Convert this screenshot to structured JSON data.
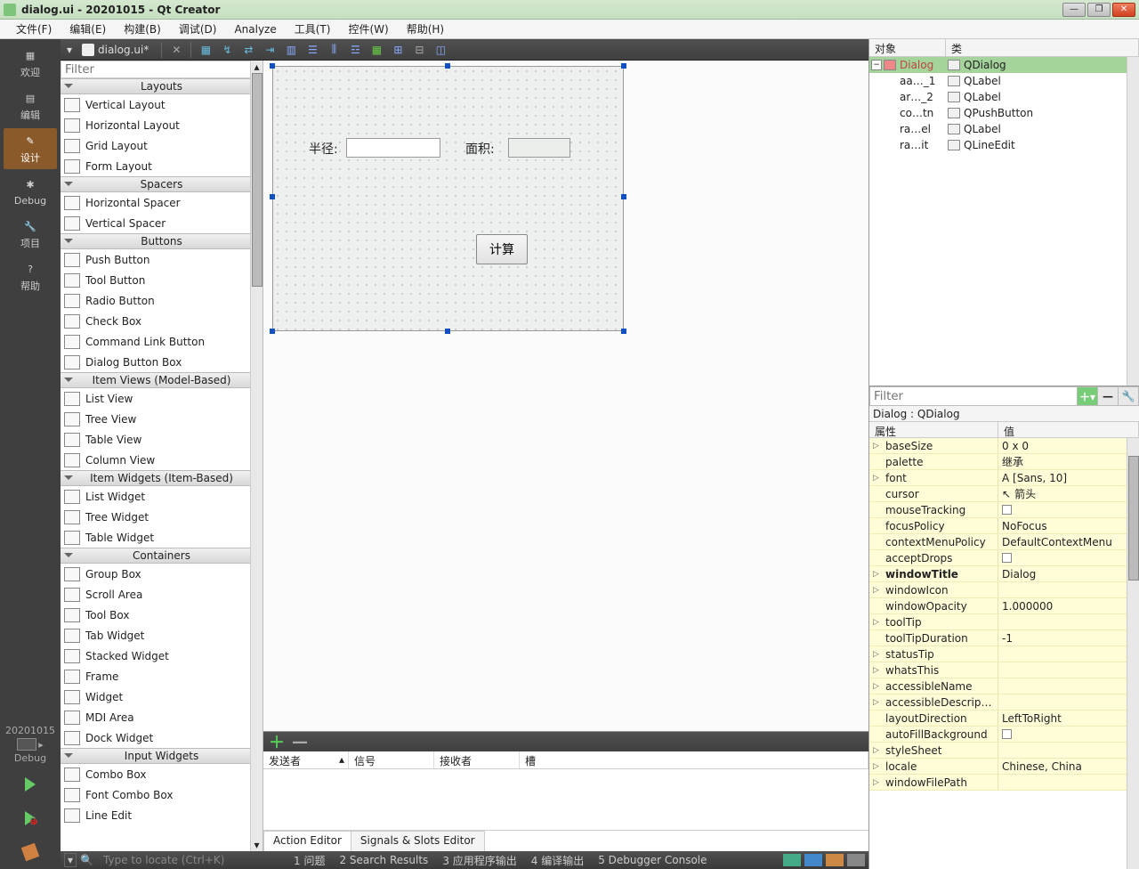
{
  "window": {
    "title": "dialog.ui - 20201015 - Qt Creator"
  },
  "menus": [
    "文件(F)",
    "编辑(E)",
    "构建(B)",
    "调试(D)",
    "Analyze",
    "工具(T)",
    "控件(W)",
    "帮助(H)"
  ],
  "modebar": {
    "items": [
      {
        "label": "欢迎",
        "icon": "grid"
      },
      {
        "label": "编辑",
        "icon": "doc"
      },
      {
        "label": "设计",
        "icon": "pencil",
        "active": true
      },
      {
        "label": "Debug",
        "icon": "bug"
      },
      {
        "label": "项目",
        "icon": "wrench"
      },
      {
        "label": "帮助",
        "icon": "help"
      }
    ],
    "kit": "20201015",
    "target": "Debug"
  },
  "tab": {
    "name": "dialog.ui*"
  },
  "widgetbox": {
    "filter_placeholder": "Filter",
    "groups": [
      {
        "title": "Layouts",
        "items": [
          "Vertical Layout",
          "Horizontal Layout",
          "Grid Layout",
          "Form Layout"
        ]
      },
      {
        "title": "Spacers",
        "items": [
          "Horizontal Spacer",
          "Vertical Spacer"
        ]
      },
      {
        "title": "Buttons",
        "items": [
          "Push Button",
          "Tool Button",
          "Radio Button",
          "Check Box",
          "Command Link Button",
          "Dialog Button Box"
        ]
      },
      {
        "title": "Item Views (Model-Based)",
        "items": [
          "List View",
          "Tree View",
          "Table View",
          "Column View"
        ]
      },
      {
        "title": "Item Widgets (Item-Based)",
        "items": [
          "List Widget",
          "Tree Widget",
          "Table Widget"
        ]
      },
      {
        "title": "Containers",
        "items": [
          "Group Box",
          "Scroll Area",
          "Tool Box",
          "Tab Widget",
          "Stacked Widget",
          "Frame",
          "Widget",
          "MDI Area",
          "Dock Widget"
        ]
      },
      {
        "title": "Input Widgets",
        "items": [
          "Combo Box",
          "Font Combo Box",
          "Line Edit"
        ]
      }
    ]
  },
  "form": {
    "label_radius": "半径:",
    "label_area": "面积:",
    "button_compute": "计算"
  },
  "signals": {
    "headers": [
      "发送者",
      "信号",
      "接收者",
      "槽"
    ],
    "tabs": [
      "Action Editor",
      "Signals & Slots Editor"
    ],
    "active_tab": 0
  },
  "objtree": {
    "headers": [
      "对象",
      "类"
    ],
    "root": {
      "name": "Dialog",
      "class": "QDialog"
    },
    "children": [
      {
        "name": "aa…_1",
        "class": "QLabel"
      },
      {
        "name": "ar…_2",
        "class": "QLabel"
      },
      {
        "name": "co…tn",
        "class": "QPushButton"
      },
      {
        "name": "ra…el",
        "class": "QLabel"
      },
      {
        "name": "ra…it",
        "class": "QLineEdit"
      }
    ]
  },
  "props": {
    "filter_placeholder": "Filter",
    "object": "Dialog : QDialog",
    "headers": [
      "属性",
      "值"
    ],
    "rows": [
      {
        "name": "baseSize",
        "value": "0 x 0",
        "expandable": true
      },
      {
        "name": "palette",
        "value": "继承"
      },
      {
        "name": "font",
        "value": "A  [Sans, 10]",
        "expandable": true
      },
      {
        "name": "cursor",
        "value": "箭头",
        "cursor": true
      },
      {
        "name": "mouseTracking",
        "value": "",
        "checkbox": true
      },
      {
        "name": "focusPolicy",
        "value": "NoFocus"
      },
      {
        "name": "contextMenuPolicy",
        "value": "DefaultContextMenu"
      },
      {
        "name": "acceptDrops",
        "value": "",
        "checkbox": true
      },
      {
        "name": "windowTitle",
        "value": "Dialog",
        "expandable": true,
        "bold": true
      },
      {
        "name": "windowIcon",
        "value": "",
        "expandable": true
      },
      {
        "name": "windowOpacity",
        "value": "1.000000"
      },
      {
        "name": "toolTip",
        "value": "",
        "expandable": true
      },
      {
        "name": "toolTipDuration",
        "value": "-1"
      },
      {
        "name": "statusTip",
        "value": "",
        "expandable": true
      },
      {
        "name": "whatsThis",
        "value": "",
        "expandable": true
      },
      {
        "name": "accessibleName",
        "value": "",
        "expandable": true
      },
      {
        "name": "accessibleDescrip…",
        "value": "",
        "expandable": true
      },
      {
        "name": "layoutDirection",
        "value": "LeftToRight"
      },
      {
        "name": "autoFillBackground",
        "value": "",
        "checkbox": true
      },
      {
        "name": "styleSheet",
        "value": "",
        "expandable": true
      },
      {
        "name": "locale",
        "value": "Chinese, China",
        "expandable": true
      },
      {
        "name": "windowFilePath",
        "value": "",
        "expandable": true
      }
    ]
  },
  "locator": {
    "placeholder": "Type to locate (Ctrl+K)"
  },
  "output_tabs": [
    "1  问题",
    "2  Search Results",
    "3  应用程序输出",
    "4  编译输出",
    "5  Debugger Console"
  ]
}
